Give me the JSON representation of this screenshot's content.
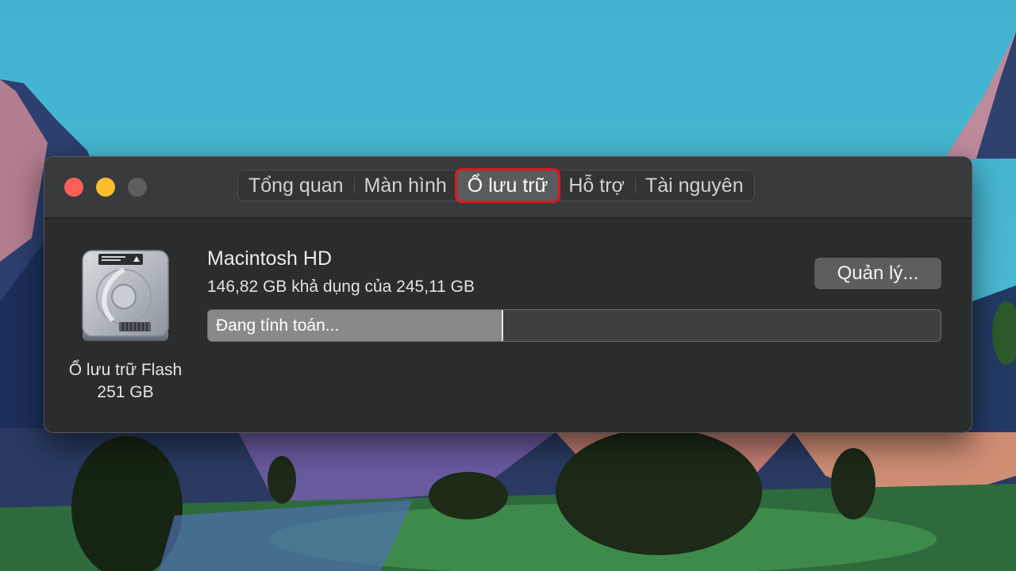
{
  "window": {
    "tabs": [
      {
        "label": "Tổng quan"
      },
      {
        "label": "Màn hình"
      },
      {
        "label": "Ổ lưu trữ",
        "active": true
      },
      {
        "label": "Hỗ trợ"
      },
      {
        "label": "Tài nguyên"
      }
    ],
    "highlight_color": "#e0161f"
  },
  "disk": {
    "icon": "hard-drive-icon",
    "caption_line1": "Ổ lưu trữ Flash",
    "caption_line2": "251 GB",
    "name": "Macintosh HD",
    "available": "146,82 GB khả dụng của 245,11 GB",
    "bar_label": "Đang tính toán...",
    "used_fraction": 0.401
  },
  "manage_button_label": "Quản lý..."
}
